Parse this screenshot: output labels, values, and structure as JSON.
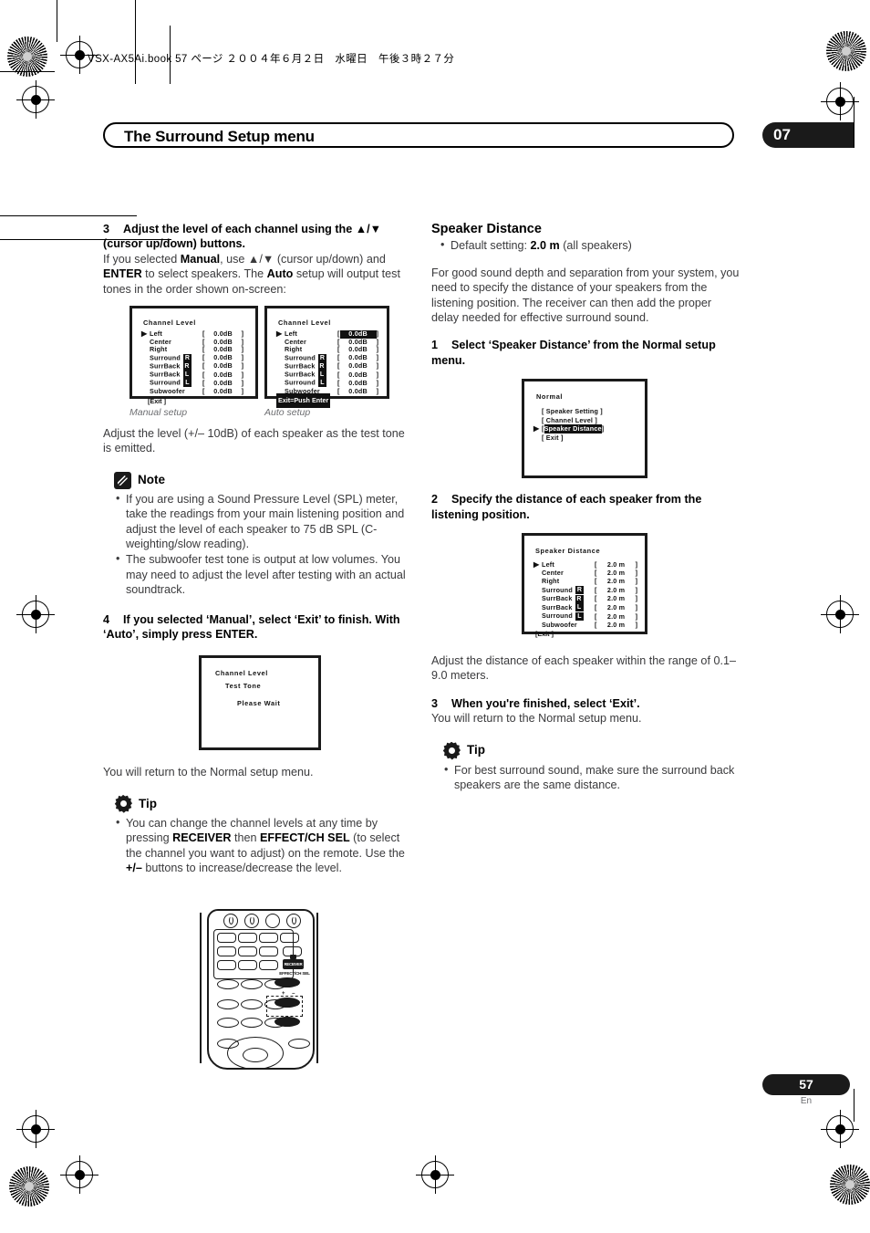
{
  "header": {
    "book_line": "VSX-AX5Ai.book  57 ページ  ２００４年６月２日　水曜日　午後３時２７分"
  },
  "title_bar": {
    "title": "The Surround Setup menu",
    "chapter": "07"
  },
  "left_column": {
    "step3": {
      "number": "3",
      "heading": "Adjust the level of each channel using the ▲/▼ (cursor up/down) buttons.",
      "body_1": "If you selected ",
      "body_b1": "Manual",
      "body_2": ", use ▲/▼ (cursor up/down) and ",
      "body_b2": "ENTER",
      "body_3": " to select speakers. The ",
      "body_b3": "Auto",
      "body_4": " setup will output test tones in the order shown on-screen:"
    },
    "osd_manual": {
      "title": "Channel Level",
      "caption": "Manual setup",
      "rows": [
        {
          "name": "Left",
          "chip": "",
          "value": "0.0dB",
          "cursor": true,
          "highlight": false
        },
        {
          "name": "Center",
          "chip": "",
          "value": "0.0dB",
          "cursor": false,
          "highlight": false
        },
        {
          "name": "Right",
          "chip": "",
          "value": "0.0dB",
          "cursor": false,
          "highlight": false
        },
        {
          "name": "Surround",
          "chip": "R",
          "value": "0.0dB",
          "cursor": false,
          "highlight": false
        },
        {
          "name": "SurrBack",
          "chip": "R",
          "value": "0.0dB",
          "cursor": false,
          "highlight": false
        },
        {
          "name": "SurrBack",
          "chip": "L",
          "value": "0.0dB",
          "cursor": false,
          "highlight": false
        },
        {
          "name": "Surround",
          "chip": "L",
          "value": "0.0dB",
          "cursor": false,
          "highlight": false
        },
        {
          "name": "Subwoofer",
          "chip": "",
          "value": "0.0dB",
          "cursor": false,
          "highlight": false
        }
      ],
      "exit_label": "[Exit ]"
    },
    "osd_auto": {
      "title": "Channel Level",
      "caption": "Auto setup",
      "rows": [
        {
          "name": "Left",
          "chip": "",
          "value": "0.0dB",
          "cursor": true,
          "highlight": true
        },
        {
          "name": "Center",
          "chip": "",
          "value": "0.0dB",
          "cursor": false,
          "highlight": false
        },
        {
          "name": "Right",
          "chip": "",
          "value": "0.0dB",
          "cursor": false,
          "highlight": false
        },
        {
          "name": "Surround",
          "chip": "R",
          "value": "0.0dB",
          "cursor": false,
          "highlight": false
        },
        {
          "name": "SurrBack",
          "chip": "R",
          "value": "0.0dB",
          "cursor": false,
          "highlight": false
        },
        {
          "name": "SurrBack",
          "chip": "L",
          "value": "0.0dB",
          "cursor": false,
          "highlight": false
        },
        {
          "name": "Surround",
          "chip": "L",
          "value": "0.0dB",
          "cursor": false,
          "highlight": false
        },
        {
          "name": "Subwoofer",
          "chip": "",
          "value": "0.0dB",
          "cursor": false,
          "highlight": false
        }
      ],
      "exit_label": "Exit=Push Enter"
    },
    "after_osd": "Adjust the level (+/– 10dB) of each speaker as the test tone is emitted.",
    "note": {
      "icon": "pencil-note-icon",
      "label": "Note",
      "items": [
        "If you are using a Sound Pressure Level (SPL) meter, take the readings from your main listening position and adjust the level of each speaker to 75 dB SPL (C-weighting/slow reading).",
        "The subwoofer test tone is output at low volumes. You may need to adjust the level after testing with an actual soundtrack."
      ]
    },
    "step4": {
      "number": "4",
      "heading": "If you selected ‘Manual’, select ‘Exit’ to finish. With ‘Auto’, simply press ENTER."
    },
    "osd_testtone": {
      "title": "Channel Level",
      "line1": "Test Tone",
      "line2": "Please Wait"
    },
    "after_testtone": "You will return to the Normal setup menu.",
    "tip": {
      "icon": "gear-tip-icon",
      "label": "Tip",
      "item_1": "You can change the channel levels at any time by pressing ",
      "item_b1": "RECEIVER",
      "item_2": " then ",
      "item_b2": "EFFECT/CH SEL",
      "item_3": " (to select the channel you want to adjust) on the remote. Use the ",
      "item_b3": "+/–",
      "item_4": " buttons to increase/decrease the level."
    },
    "remote": {
      "receiver_label": "RECEIVER",
      "effect_label": "EFFECT/CH SEL",
      "plus_minus_label": "+ –"
    }
  },
  "right_column": {
    "section_title": "Speaker Distance",
    "default_setting_1": "Default setting: ",
    "default_setting_b": "2.0 m",
    "default_setting_2": " (all speakers)",
    "intro": "For good sound depth and separation from your system, you need to specify the distance of your speakers from the listening position. The receiver can then add the proper delay needed for effective surround sound.",
    "step1": {
      "number": "1",
      "heading": "Select ‘Speaker Distance’ from the Normal setup menu."
    },
    "osd_normal": {
      "title": "Normal",
      "items": [
        {
          "label": "[ Speaker Setting  ]",
          "cursor": false,
          "highlight": false
        },
        {
          "label": "[ Channel Level    ]",
          "cursor": false,
          "highlight": false
        },
        {
          "label": "Speaker Distance",
          "cursor": true,
          "highlight": true,
          "brackets": true
        },
        {
          "label": "[ Exit            ]",
          "cursor": false,
          "highlight": false
        }
      ]
    },
    "step2": {
      "number": "2",
      "heading": "Specify the distance of each speaker from the listening position."
    },
    "osd_distance": {
      "title": "Speaker Distance",
      "rows": [
        {
          "name": "Left",
          "chip": "",
          "value": "2.0 m",
          "cursor": true
        },
        {
          "name": "Center",
          "chip": "",
          "value": "2.0 m",
          "cursor": false
        },
        {
          "name": "Right",
          "chip": "",
          "value": "2.0 m",
          "cursor": false
        },
        {
          "name": "Surround",
          "chip": "R",
          "value": "2.0 m",
          "cursor": false
        },
        {
          "name": "SurrBack",
          "chip": "R",
          "value": "2.0 m",
          "cursor": false
        },
        {
          "name": "SurrBack",
          "chip": "L",
          "value": "2.0 m",
          "cursor": false
        },
        {
          "name": "Surround",
          "chip": "L",
          "value": "2.0 m",
          "cursor": false
        },
        {
          "name": "Subwoofer",
          "chip": "",
          "value": "2.0 m",
          "cursor": false
        }
      ],
      "exit_label": "[Exit ]"
    },
    "after_distance": "Adjust the distance of each speaker within the range of 0.1–9.0 meters.",
    "step3": {
      "number": "3",
      "heading": "When you're finished, select ‘Exit’.",
      "body": "You will return to the Normal setup menu."
    },
    "tip": {
      "icon": "gear-tip-icon",
      "label": "Tip",
      "item": "For best surround sound, make sure the surround back speakers are the same distance."
    }
  },
  "footer": {
    "page_number": "57",
    "language": "En"
  },
  "colors": {
    "ink": "#231f20",
    "body_text": "#3a3a3c",
    "badge": "#1a1a1a",
    "caption": "#6d6e71"
  }
}
